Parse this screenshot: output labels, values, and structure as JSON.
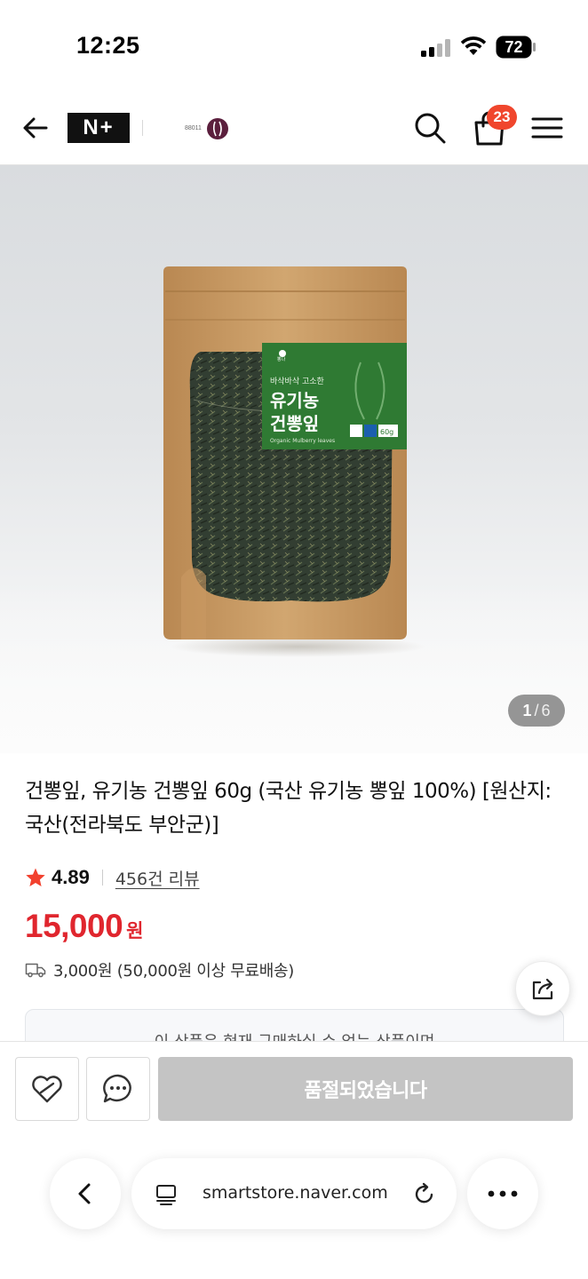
{
  "status_bar": {
    "time": "12:25",
    "battery_level": "72",
    "icons": [
      "signal-icon",
      "wifi-icon",
      "battery-icon"
    ]
  },
  "header": {
    "back_icon": "arrow-left-icon",
    "nplus_label": "N+",
    "store_logo_text": "88011",
    "search_icon": "search-icon",
    "cart_icon": "shopping-bag-icon",
    "cart_count": "23",
    "menu_icon": "hamburger-menu-icon"
  },
  "gallery": {
    "current_page": "1",
    "separator": "/",
    "total_pages": "6",
    "package": {
      "label_subtitle": "바삭바삭 고소한",
      "label_title_line1": "유기농",
      "label_title_line2": "건뽕잎",
      "label_english": "Organic Mulberry leaves",
      "label_weight": "60g",
      "label_brand": "뽕나"
    }
  },
  "product": {
    "title": "건뽕잎, 유기농 건뽕잎 60g (국산 유기농 뽕잎 100%) [원산지:국산(전라북도 부안군)]",
    "rating": "4.89",
    "review_link": "456건 리뷰",
    "price": "15,000",
    "price_unit": "원",
    "shipping": "3,000원 (50,000원 이상 무료배송)",
    "notice": "이 상품은 현재 구매하실 수 없는 상품이며"
  },
  "purchase_bar": {
    "wish_icon": "heart-icon",
    "talk_icon": "chat-bubble-icon",
    "soldout_label": "품절되었습니다"
  },
  "browser": {
    "url": "smartstore.naver.com",
    "back_icon": "chevron-left-icon",
    "reader_icon": "reader-mode-icon",
    "reload_icon": "reload-icon",
    "more_icon": "more-dots-icon"
  },
  "colors": {
    "price": "#e0262e",
    "badge": "#f0462d",
    "soldout_button": "#c4c4c4",
    "label_green": "#2f7a33",
    "pouch_kraft": "#c99a63"
  }
}
